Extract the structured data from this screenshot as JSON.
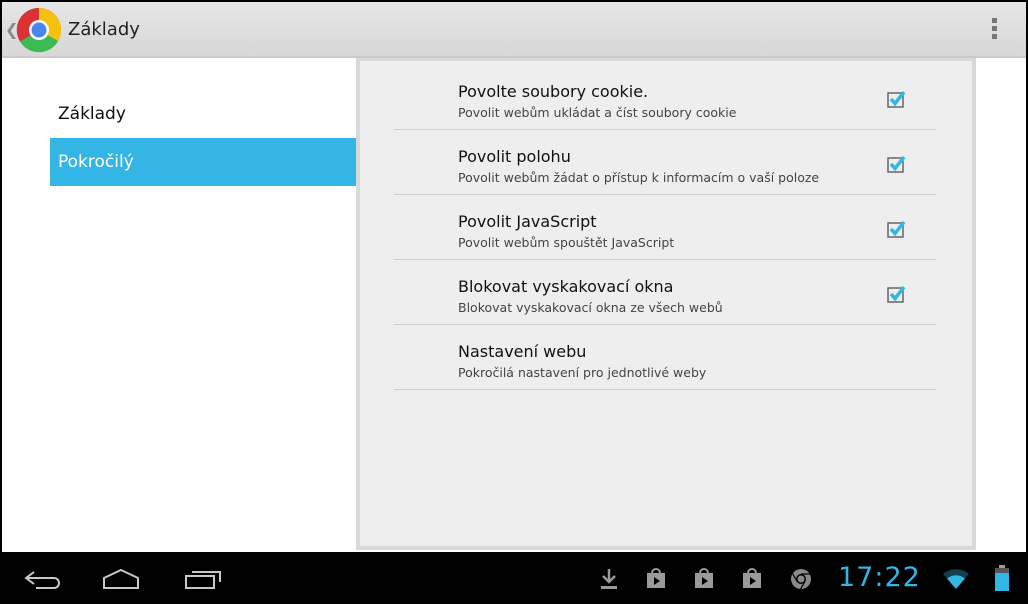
{
  "action_bar": {
    "title": "Základy",
    "app_icon": "chrome-icon",
    "overflow_icon": "overflow-menu-icon"
  },
  "nav": {
    "items": [
      {
        "label": "Základy",
        "active": false
      },
      {
        "label": "Pokročilý",
        "active": true
      }
    ]
  },
  "preferences": [
    {
      "title": "Povolte soubory cookie.",
      "summary": "Povolit webům ukládat a číst soubory cookie",
      "checked": true
    },
    {
      "title": "Povolit polohu",
      "summary": "Povolit webům žádat o přístup k informacím o vaší poloze",
      "checked": true
    },
    {
      "title": "Povolit JavaScript",
      "summary": "Povolit webům spouštět JavaScript",
      "checked": true
    },
    {
      "title": "Blokovat vyskakovací okna",
      "summary": "Blokovat vyskakovací okna ze všech webů",
      "checked": true
    },
    {
      "title": "Nastavení webu",
      "summary": "Pokročilá nastavení pro jednotlivé weby",
      "checked": null
    }
  ],
  "system_bar": {
    "time": "17:22",
    "nav_icons": [
      "back-icon",
      "home-icon",
      "recent-apps-icon"
    ],
    "notification_icons": [
      "download-icon",
      "play-store-icon",
      "play-store-icon",
      "play-store-icon",
      "chrome-icon"
    ],
    "status_icons": [
      "wifi-icon",
      "battery-icon"
    ]
  },
  "colors": {
    "accent": "#33b5e5",
    "panel_bg": "#eeeeee",
    "action_bar_bg": "#dcdcdc"
  }
}
